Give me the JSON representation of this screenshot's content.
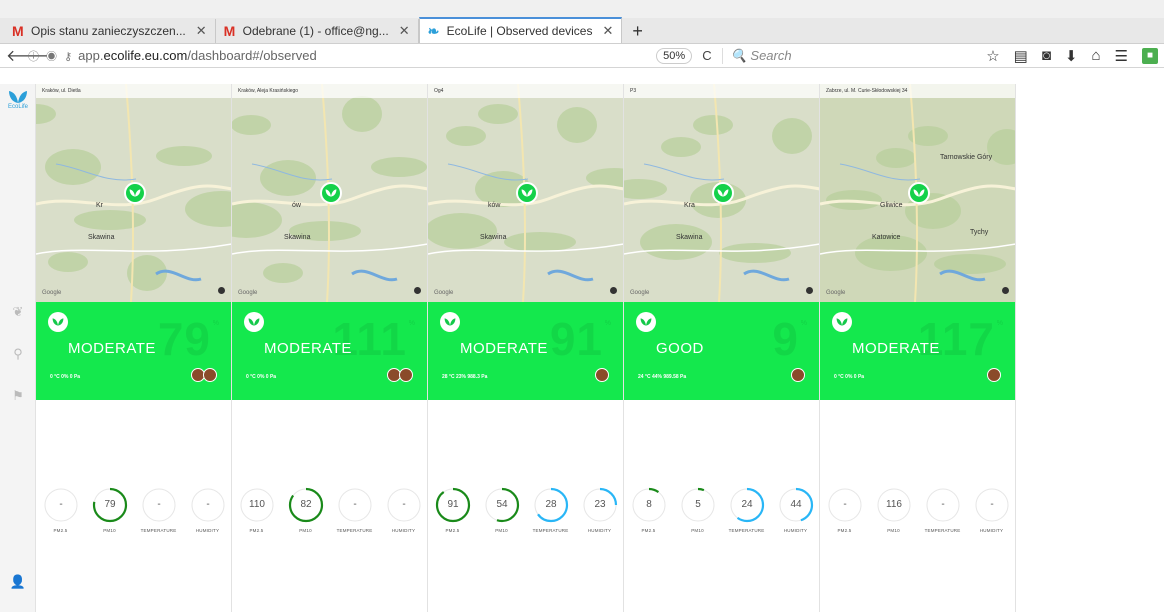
{
  "browser": {
    "tabs": [
      {
        "title": "Opis stanu zanieczyszczen...",
        "icon": "gmail-icon"
      },
      {
        "title": "Odebrane (1) - office@ng...",
        "icon": "gmail-icon"
      },
      {
        "title": "EcoLife | Observed devices",
        "icon": "ecolife-icon",
        "active": true
      }
    ],
    "url_prefix": "app.",
    "url_domain": "ecolife.eu.com",
    "url_path": "/dashboard#/observed",
    "zoom": "50%",
    "search_placeholder": "Search"
  },
  "app": {
    "logo_text": "EcoLife",
    "accent": "#14e84d",
    "brand": "#2b9fd9"
  },
  "devices": [
    {
      "location": "Kraków, ul. Dietla",
      "quality": "MODERATE",
      "index": "79",
      "meta": "0 °C  0%  0 Pa",
      "avatars": 2,
      "cities": [
        "Kr",
        "Skawina"
      ],
      "gauges": [
        {
          "label": "PM2.5",
          "value": "-",
          "fill": 0,
          "color": "#1a8a1a"
        },
        {
          "label": "PM10",
          "value": "79",
          "fill": 0.78,
          "color": "#1a8a1a"
        },
        {
          "label": "TEMPERATURE",
          "value": "-",
          "fill": 0,
          "color": "#29b6f6"
        },
        {
          "label": "HUMIDITY",
          "value": "-",
          "fill": 0,
          "color": "#29b6f6"
        }
      ]
    },
    {
      "location": "Kraków, Aleja Krasińskiego",
      "quality": "MODERATE",
      "index": "111",
      "meta": "0 °C  0%  0 Pa",
      "avatars": 2,
      "cities": [
        "ów",
        "Skawina"
      ],
      "gauges": [
        {
          "label": "PM2.5",
          "value": "110",
          "fill": 0,
          "color": "#1a8a1a"
        },
        {
          "label": "PM10",
          "value": "82",
          "fill": 0.85,
          "color": "#1a8a1a"
        },
        {
          "label": "TEMPERATURE",
          "value": "-",
          "fill": 0,
          "color": "#29b6f6"
        },
        {
          "label": "HUMIDITY",
          "value": "-",
          "fill": 0,
          "color": "#29b6f6"
        }
      ]
    },
    {
      "location": "Og4",
      "quality": "MODERATE",
      "index": "91",
      "meta": "28 °C  23%  988.3 Pa",
      "avatars": 1,
      "cities": [
        "ków",
        "Skawina"
      ],
      "gauges": [
        {
          "label": "PM2.5",
          "value": "91",
          "fill": 0.9,
          "color": "#1a8a1a"
        },
        {
          "label": "PM10",
          "value": "54",
          "fill": 0.55,
          "color": "#1a8a1a"
        },
        {
          "label": "TEMPERATURE",
          "value": "28",
          "fill": 0.65,
          "color": "#29b6f6"
        },
        {
          "label": "HUMIDITY",
          "value": "23",
          "fill": 0.25,
          "color": "#29b6f6"
        }
      ]
    },
    {
      "location": "P3",
      "quality": "GOOD",
      "index": "9",
      "meta": "24 °C  44%  989.58 Pa",
      "avatars": 1,
      "cities": [
        "Kra",
        "Skawina"
      ],
      "gauges": [
        {
          "label": "PM2.5",
          "value": "8",
          "fill": 0.1,
          "color": "#1a8a1a"
        },
        {
          "label": "PM10",
          "value": "5",
          "fill": 0.06,
          "color": "#1a8a1a"
        },
        {
          "label": "TEMPERATURE",
          "value": "24",
          "fill": 0.6,
          "color": "#29b6f6"
        },
        {
          "label": "HUMIDITY",
          "value": "44",
          "fill": 0.45,
          "color": "#29b6f6"
        }
      ]
    },
    {
      "location": "Zabrze, ul. M. Curie-Skłodowskiej 34",
      "quality": "MODERATE",
      "index": "117",
      "meta": "0 °C  0%  0 Pa",
      "avatars": 1,
      "cities": [
        "Gliwice",
        "Katowice",
        "Tarnowskie Góry",
        "Tychy"
      ],
      "gauges": [
        {
          "label": "PM2.5",
          "value": "-",
          "fill": 0,
          "color": "#1a8a1a"
        },
        {
          "label": "PM10",
          "value": "116",
          "fill": 0,
          "color": "#1a8a1a"
        },
        {
          "label": "TEMPERATURE",
          "value": "-",
          "fill": 0,
          "color": "#29b6f6"
        },
        {
          "label": "HUMIDITY",
          "value": "-",
          "fill": 0,
          "color": "#29b6f6"
        }
      ]
    }
  ]
}
